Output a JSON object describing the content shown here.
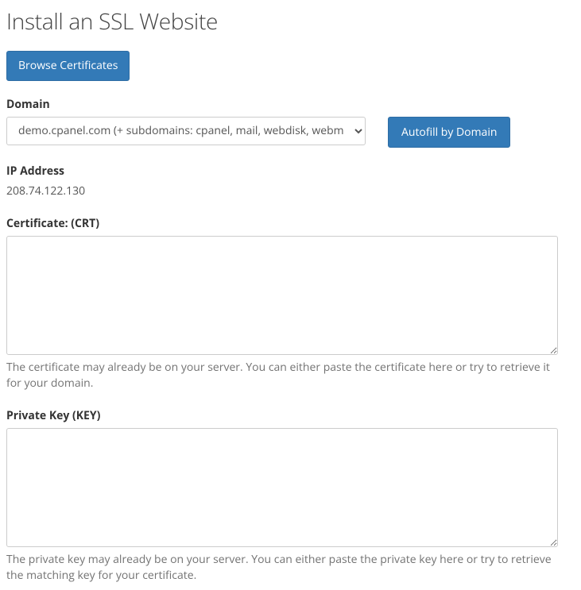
{
  "page_title": "Install an SSL Website",
  "browse_button": "Browse Certificates",
  "domain": {
    "label": "Domain",
    "selected": "demo.cpanel.com   (+ subdomains: cpanel, mail, webdisk, webmail, www)"
  },
  "autofill_button": "Autofill by Domain",
  "ip": {
    "label": "IP Address",
    "value": "208.74.122.130"
  },
  "crt": {
    "label": "Certificate: (CRT)",
    "value": "",
    "help": "The certificate may already be on your server. You can either paste the certificate here or try to retrieve it for your domain."
  },
  "key": {
    "label": "Private Key (KEY)",
    "value": "",
    "help": "The private key may already be on your server. You can either paste the private key here or try to retrieve the matching key for your certificate."
  }
}
